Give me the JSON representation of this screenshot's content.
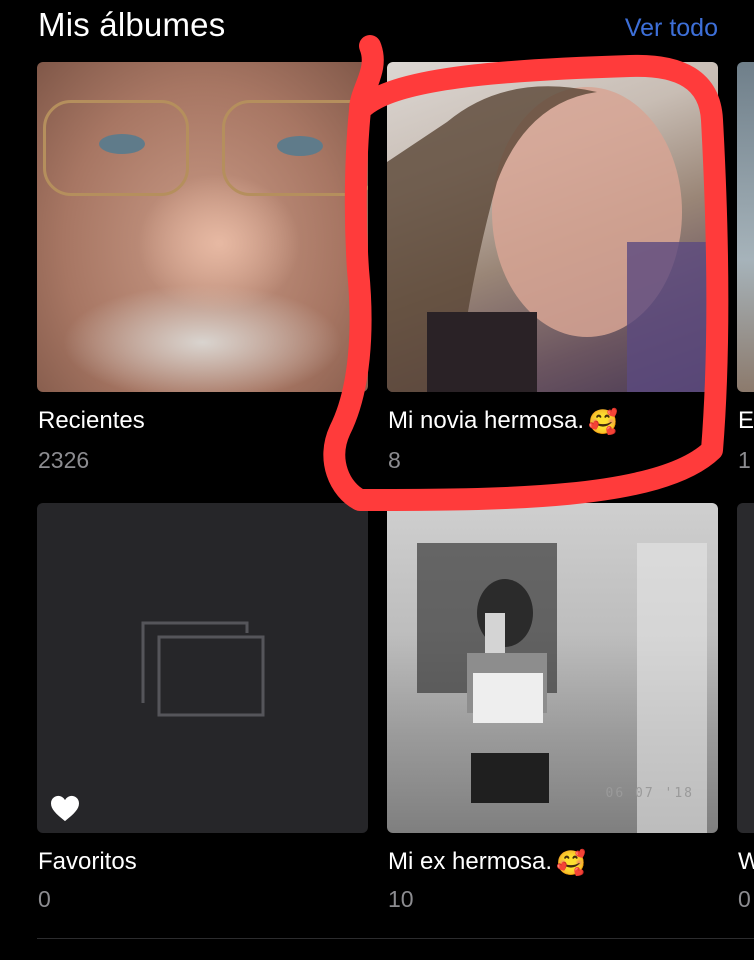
{
  "header": {
    "title": "Mis álbumes",
    "see_all_label": "Ver todo"
  },
  "albums": [
    {
      "label": "Recientes",
      "count": "2326",
      "emoji": ""
    },
    {
      "label": "Mi novia hermosa.",
      "count": "8",
      "emoji": "🥰"
    },
    {
      "label": "E",
      "count": "1",
      "emoji": ""
    },
    {
      "label": "Favoritos",
      "count": "0",
      "emoji": ""
    },
    {
      "label": "Mi ex hermosa.",
      "count": "10",
      "emoji": "🥰"
    },
    {
      "label": "W",
      "count": "0",
      "emoji": ""
    }
  ],
  "photo_stamps": {
    "ex_date": "06 07 '18"
  },
  "colors": {
    "background": "#000000",
    "accent_link": "#3d6fd8",
    "count_text": "#8c8c90",
    "annotation_red": "#ff3b3b",
    "placeholder_bg": "#262629"
  }
}
